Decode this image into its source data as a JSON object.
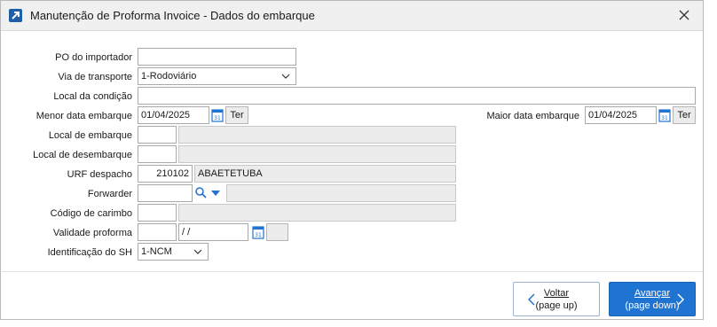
{
  "window": {
    "title": "Manutenção de Proforma Invoice - Dados do embarque"
  },
  "form": {
    "po_label": "PO do importador",
    "po_value": "",
    "via_label": "Via de transporte",
    "via_value": "1-Rodoviário",
    "local_condicao_label": "Local da condição",
    "local_condicao_value": "",
    "menor_data_label": "Menor data embarque",
    "menor_data_value": "01/04/2025",
    "menor_data_day": "Ter",
    "maior_data_label": "Maior data embarque",
    "maior_data_value": "01/04/2025",
    "maior_data_day": "Ter",
    "local_embarque_label": "Local de embarque",
    "local_embarque_code": "",
    "local_embarque_desc": "",
    "local_desembarque_label": "Local de desembarque",
    "local_desembarque_code": "",
    "local_desembarque_desc": "",
    "urf_label": "URF despacho",
    "urf_code": "210102",
    "urf_desc": "ABAETETUBA",
    "forwarder_label": "Forwarder",
    "forwarder_code": "",
    "forwarder_desc": "",
    "carimbo_label": "Código de carimbo",
    "carimbo_code": "",
    "carimbo_desc": "",
    "validade_label": "Validade proforma",
    "validade_days": "",
    "validade_date": " / /",
    "validade_day": "",
    "sh_label": "Identificação do SH",
    "sh_value": "1-NCM"
  },
  "buttons": {
    "back_line1": "Voltar",
    "back_line2": "(page up)",
    "next_line1": "Avançar",
    "next_line2": "(page down)"
  },
  "icons": {
    "app": "app-arrow-icon",
    "close": "close-icon",
    "calendar": "calendar-icon",
    "search": "search-icon",
    "dropdown": "chevron-down-icon"
  },
  "colors": {
    "primary_button": "#1f73d1",
    "calendar_accent": "#1f73d1"
  }
}
